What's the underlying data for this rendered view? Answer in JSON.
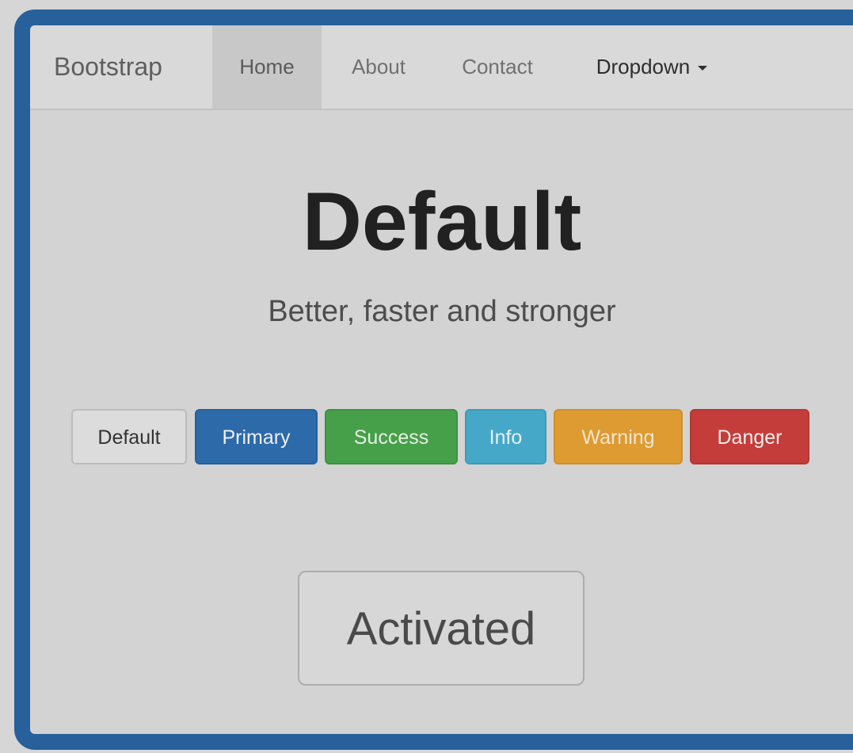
{
  "navbar": {
    "brand": "Bootstrap",
    "items": [
      {
        "label": "Home",
        "active": true
      },
      {
        "label": "About",
        "active": false
      },
      {
        "label": "Contact",
        "active": false
      },
      {
        "label": "Dropdown",
        "active": false
      }
    ]
  },
  "hero": {
    "title": "Default",
    "subtitle": "Better, faster and stronger"
  },
  "buttons": [
    {
      "label": "Default",
      "color": "#dcdcdc"
    },
    {
      "label": "Primary",
      "color": "#2c6aaa"
    },
    {
      "label": "Success",
      "color": "#46a049"
    },
    {
      "label": "Info",
      "color": "#46a8c8"
    },
    {
      "label": "Warning",
      "color": "#de9b32"
    },
    {
      "label": "Danger",
      "color": "#c43d3a"
    }
  ],
  "activated_button": {
    "label": "Activated"
  },
  "icons": {
    "dropdown": "caret-down-icon"
  },
  "theme": {
    "frame_border": "#27609a"
  }
}
